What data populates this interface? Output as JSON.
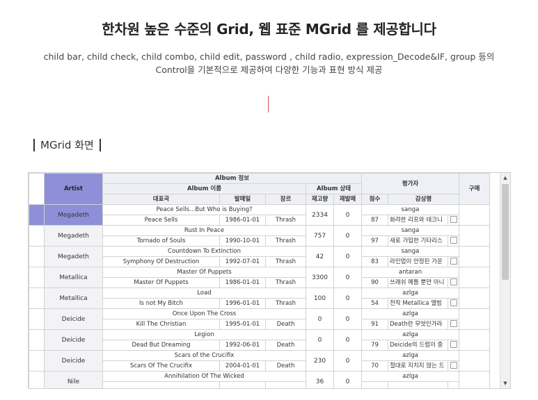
{
  "heading": {
    "title": "한차원 높은 수준의 Grid, 웹 표준 MGrid 를 제공합니다",
    "line1": "child bar, child check, child combo, child edit, password , child radio, expression_Decode&IF, group 등의",
    "line2": "Control을 기본적으로 제공하여 다양한 기능과 표현 방식 제공"
  },
  "section": {
    "title": "MGrid 화면"
  },
  "grid": {
    "headers": {
      "artist": "Artist",
      "album_info": "Album 정보",
      "album_name": "Album 이름",
      "album_status": "Album 상태",
      "main_song": "대표곡",
      "release_date": "발매일",
      "genre": "장르",
      "stock": "재고량",
      "reissue": "재발매",
      "reviewer_group": "평가자",
      "score": "점수",
      "review": "감상평",
      "buy": "구매"
    },
    "rows": [
      {
        "artist": "Megadeth",
        "album": "Peace Sells...But Who is Buying?",
        "song": "Peace Sells",
        "date": "1986-01-01",
        "genre": "Thrash",
        "stock": "2334",
        "reissue": "0",
        "reviewer": "sanga",
        "score": "87",
        "comment": "화려한 리프와 테크니"
      },
      {
        "artist": "Megadeth",
        "album": "Rust In Peace",
        "song": "Tornado of Souls",
        "date": "1990-10-01",
        "genre": "Thrash",
        "stock": "757",
        "reissue": "0",
        "reviewer": "sanga",
        "score": "97",
        "comment": "새로 가입한 기타리스"
      },
      {
        "artist": "Megadeth",
        "album": "Countdown To Extinction",
        "song": "Symphony Of Destruction",
        "date": "1992-07-01",
        "genre": "Thrash",
        "stock": "42",
        "reissue": "0",
        "reviewer": "sanga",
        "score": "83",
        "comment": "라인업이 안정된 가운"
      },
      {
        "artist": "Metallica",
        "album": "Master Of Puppets",
        "song": "Master Of Puppets",
        "date": "1986-01-01",
        "genre": "Thrash",
        "stock": "3300",
        "reissue": "0",
        "reviewer": "antaran",
        "score": "90",
        "comment": "쓰래쉬 메틀 뿐만 아니"
      },
      {
        "artist": "Metallica",
        "album": "Load",
        "song": "Is not My Bitch",
        "date": "1996-01-01",
        "genre": "Thrash",
        "stock": "100",
        "reissue": "0",
        "reviewer": "azlga",
        "score": "54",
        "comment": "전작 Metallica 앨범"
      },
      {
        "artist": "Deicide",
        "album": "Once Upon The Cross",
        "song": "Kill The Christian",
        "date": "1995-01-01",
        "genre": "Death",
        "stock": "0",
        "reissue": "0",
        "reviewer": "azlga",
        "score": "91",
        "comment": "Death란 무엇인가라"
      },
      {
        "artist": "Deicide",
        "album": "Legion",
        "song": "Dead But Dreaming",
        "date": "1992-06-01",
        "genre": "Death",
        "stock": "0",
        "reissue": "0",
        "reviewer": "azlga",
        "score": "79",
        "comment": "Deicide의 드럼이 중"
      },
      {
        "artist": "Deicide",
        "album": "Scars of the Crucifix",
        "song": "Scars Of The Crucifix",
        "date": "2004-01-01",
        "genre": "Death",
        "stock": "230",
        "reissue": "0",
        "reviewer": "azlga",
        "score": "70",
        "comment": "절대로 지치지 않는 드"
      },
      {
        "artist": "Nile",
        "album": "Annihilation Of The Wicked",
        "song": "",
        "date": "",
        "genre": "",
        "stock": "36",
        "reissue": "0",
        "reviewer": "azlga",
        "score": "",
        "comment": ""
      }
    ]
  },
  "colors": {
    "accent": "#8d8fd8",
    "header_bg": "#eef0f6",
    "cursor": "#d9534f"
  }
}
